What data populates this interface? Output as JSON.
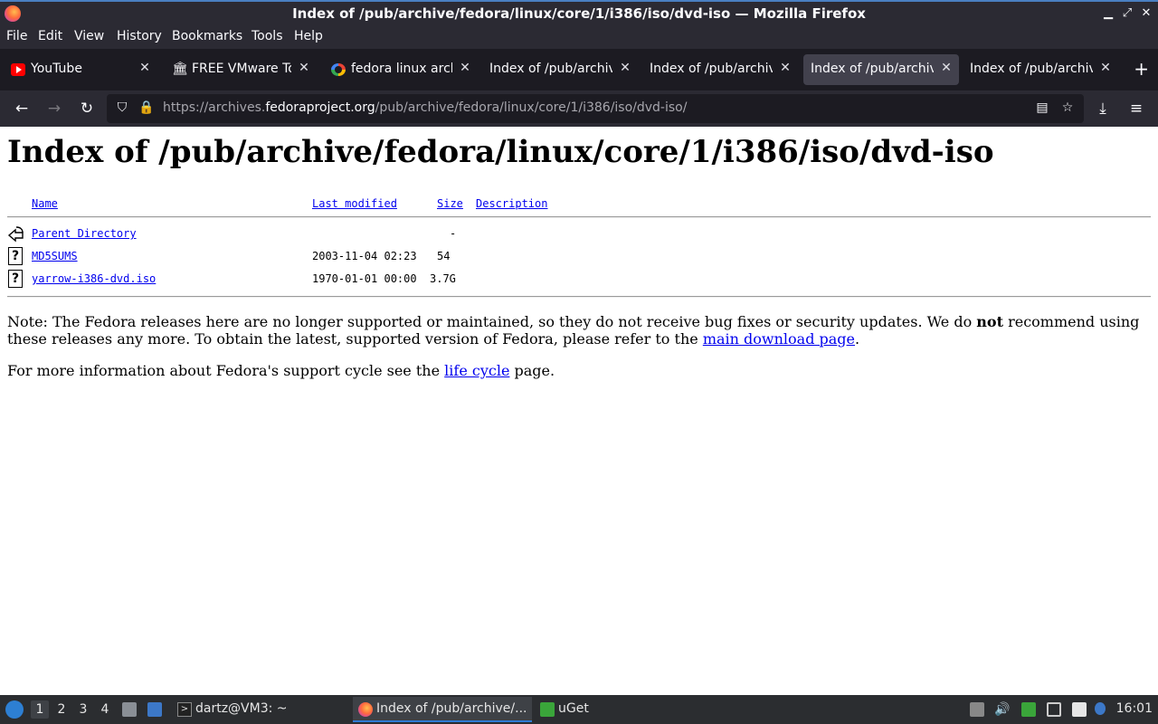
{
  "window": {
    "title": "Index of /pub/archive/fedora/linux/core/1/i386/iso/dvd-iso — Mozilla Firefox"
  },
  "menu": [
    "File",
    "Edit",
    "View",
    "History",
    "Bookmarks",
    "Tools",
    "Help"
  ],
  "tabs": [
    {
      "label": "YouTube",
      "icon": "youtube-icon"
    },
    {
      "label": "FREE VMware Tools",
      "icon": "museum-icon"
    },
    {
      "label": "fedora linux archive",
      "icon": "google-icon"
    },
    {
      "label": "Index of /pub/archive",
      "icon": ""
    },
    {
      "label": "Index of /pub/archive",
      "icon": ""
    },
    {
      "label": "Index of /pub/archive",
      "icon": "",
      "active": true
    },
    {
      "label": "Index of /pub/archive",
      "icon": ""
    }
  ],
  "nav": {
    "url_prefix": "https://archives.",
    "url_domain": "fedoraproject.org",
    "url_path": "/pub/archive/fedora/linux/core/1/i386/iso/dvd-iso/"
  },
  "page": {
    "heading": "Index of /pub/archive/fedora/linux/core/1/i386/iso/dvd-iso",
    "columns": {
      "name": "Name",
      "modified": "Last modified",
      "size": "Size",
      "description": "Description"
    },
    "rows": [
      {
        "name": "Parent Directory",
        "modified": "",
        "size": "-",
        "icon": "back-icon"
      },
      {
        "name": "MD5SUMS",
        "modified": "2003-11-04 02:23",
        "size": "54",
        "icon": "unknown-file-icon"
      },
      {
        "name": "yarrow-i386-dvd.iso",
        "modified": "1970-01-01 00:00",
        "size": "3.7G",
        "icon": "unknown-file-icon"
      }
    ],
    "note": {
      "part1": "Note: The Fedora releases here are no longer supported or maintained, so they do not receive bug fixes or security updates. We do ",
      "bold": "not",
      "part2": " recommend using these releases any more. To obtain the latest, supported version of Fedora, please refer to the ",
      "link": "main download page",
      "part3": "."
    },
    "note2": {
      "part1": "For more information about Fedora's support cycle see the ",
      "link": "life cycle",
      "part2": " page."
    }
  },
  "taskbar": {
    "workspaces": [
      "1",
      "2",
      "3",
      "4"
    ],
    "tasks": [
      {
        "label": "dartz@VM3: ~"
      },
      {
        "label": "Index of /pub/archive/...",
        "active": true
      },
      {
        "label": "uGet"
      }
    ],
    "clock": "16:01"
  },
  "colors": {
    "link": "#0000ee",
    "chrome_dark": "#2b2a33",
    "tab_strip": "#1c1b22",
    "active_task_accent": "#2f7bd4"
  }
}
